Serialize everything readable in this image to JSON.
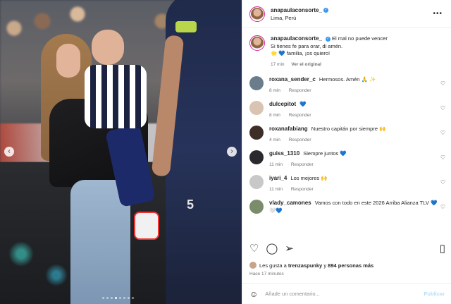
{
  "post": {
    "author": "anapaulaconsorte_",
    "location": "Lima, Perú",
    "caption_lines": [
      "El mal no puede vencer",
      "Si tienes fe para orar, di amén.",
      "🌟 💙 familia, ¡os quiero!"
    ],
    "caption_time": "17 min",
    "see_original": "Ver el original"
  },
  "comments": [
    {
      "user": "roxana_sender_c",
      "text": "Hermosos. Amén 🙏 ✨",
      "time": "8 min",
      "reply": "Responder",
      "avatar_color": "#6b7d8c"
    },
    {
      "user": "dulcepitot",
      "text": "💙",
      "time": "8 min",
      "reply": "Responder",
      "avatar_color": "#d9c3b2"
    },
    {
      "user": "roxanafabiang",
      "text": "Nuestro capitán por siempre 🙌",
      "time": "4 min",
      "reply": "Responder",
      "avatar_color": "#3e2e28"
    },
    {
      "user": "guiss_1310",
      "text": "Siempre juntos 💙",
      "time": "11 min",
      "reply": "Responder",
      "avatar_color": "#2a2a2e"
    },
    {
      "user": "iyari_4",
      "text": "Los mejores 🙌",
      "time": "11 min",
      "reply": "Responder",
      "avatar_color": "#c8c8c8"
    },
    {
      "user": "vlady_camones",
      "text": "Vamos con todo en este 2026 Arriba Alianza TLV 💙🤍💙",
      "time": "",
      "reply": "",
      "avatar_color": "#7b8c6a"
    }
  ],
  "likes": {
    "prefix": "Les gusta a",
    "user": "trenzaspunky",
    "joiner": "y",
    "others": "894 personas más"
  },
  "timestamp": "Hace 17 minutos",
  "add_comment": {
    "placeholder": "Añade un comentario...",
    "publish": "Publicar"
  },
  "icons": {
    "more": "more-horizontal-icon",
    "like": "heart-icon",
    "comment": "comment-icon",
    "share": "share-icon",
    "save": "bookmark-icon",
    "emoji": "emoji-icon"
  }
}
